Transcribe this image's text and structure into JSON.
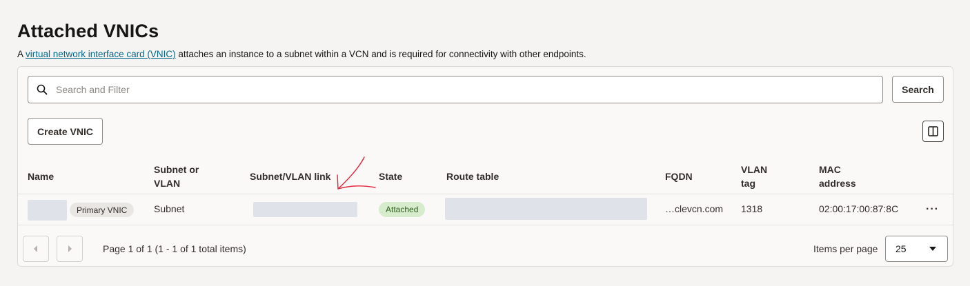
{
  "page": {
    "title": "Attached VNICs",
    "description_prefix": "A ",
    "description_link": "virtual network interface card (VNIC)",
    "description_suffix": " attaches an instance to a subnet within a VCN and is required for connectivity with other endpoints."
  },
  "toolbar": {
    "search_placeholder": "Search and Filter",
    "search_label": "Search",
    "create_label": "Create VNIC",
    "columns_icon": "column-toggle-icon"
  },
  "table": {
    "headers": {
      "name": "Name",
      "subnet_line1": "Subnet or",
      "subnet_line2": "VLAN",
      "link": "Subnet/VLAN link",
      "state": "State",
      "route_table": "Route table",
      "fqdn": "FQDN",
      "vlan_line1": "VLAN",
      "vlan_line2": "tag",
      "mac_line1": "MAC",
      "mac_line2": "address"
    },
    "rows": [
      {
        "primary_badge": "Primary VNIC",
        "subnet_type": "Subnet",
        "state": "Attached",
        "fqdn": "…clevcn.com",
        "vlan_tag": "1318",
        "mac_address": "02:00:17:00:87:8C",
        "actions_icon": "kebab-icon"
      }
    ]
  },
  "pagination": {
    "summary": "Page 1 of 1 (1 - 1 of 1 total items)",
    "items_per_page_label": "Items per page",
    "items_per_page_value": "25"
  },
  "colors": {
    "link": "#00688c",
    "attached_badge_bg": "#d7ebcd",
    "annotation_arrow": "#e0283c"
  }
}
